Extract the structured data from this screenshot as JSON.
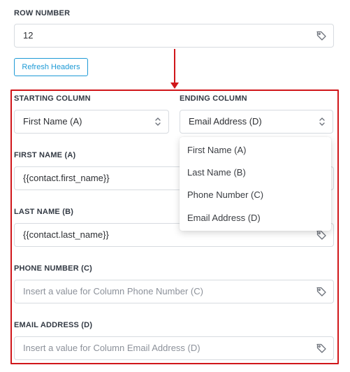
{
  "row_number": {
    "label": "ROW NUMBER",
    "value": "12"
  },
  "refresh_button": {
    "label": "Refresh Headers"
  },
  "starting_column": {
    "label": "STARTING COLUMN",
    "value": "First Name (A)"
  },
  "ending_column": {
    "label": "ENDING COLUMN",
    "value": "Email Address (D)",
    "options": [
      "First Name (A)",
      "Last Name (B)",
      "Phone Number (C)",
      "Email Address (D)"
    ]
  },
  "fields": [
    {
      "label": "FIRST NAME (A)",
      "value": "{{contact.first_name}}",
      "placeholder": ""
    },
    {
      "label": "LAST NAME (B)",
      "value": "{{contact.last_name}}",
      "placeholder": ""
    },
    {
      "label": "PHONE NUMBER (C)",
      "value": "",
      "placeholder": "Insert a value for Column Phone Number (C)"
    },
    {
      "label": "EMAIL ADDRESS (D)",
      "value": "",
      "placeholder": "Insert a value for Column Email Address (D)"
    }
  ],
  "annotation_color": "#d0161a",
  "accent_color": "#1e9ad6",
  "icons": [
    "tag-icon",
    "chevron-updown-icon",
    "arrow-down-icon"
  ]
}
